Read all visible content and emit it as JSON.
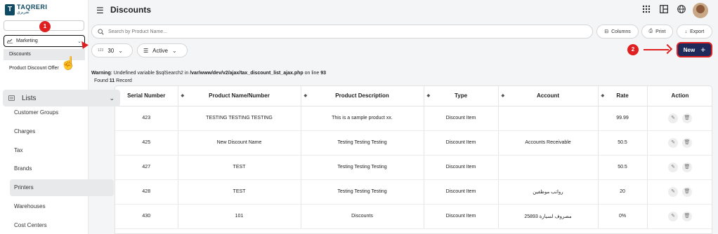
{
  "app": {
    "logo_en": "TAQRERI",
    "logo_ar": "تقريري",
    "logo_letter": "T"
  },
  "sidebar": {
    "marketing_label": "Marketing",
    "marketing_items": [
      "Discounts",
      "Product Discount Offer"
    ],
    "lists_label": "Lists",
    "list_items": [
      "Customer Groups",
      "Charges",
      "Tax",
      "Brands",
      "Printers",
      "Warehouses",
      "Cost Centers"
    ]
  },
  "annotations": {
    "step1": "1",
    "step2": "2"
  },
  "header": {
    "title": "Discounts"
  },
  "toolbar": {
    "search_placeholder": "Search by Product Name...",
    "columns_label": "Columns",
    "print_label": "Print",
    "export_label": "Export",
    "page_size_prefix": "123",
    "page_size": "30",
    "status_filter": "Active",
    "new_label": "New"
  },
  "messages": {
    "warning_prefix": "Warning",
    "warning_text": ": Undefined variable $sqlSearch2 in ",
    "warning_path": "/var/www/dev/v2/ajax/tax_discount_list_ajax.php",
    "warning_line_text": " on line ",
    "warning_line": "93",
    "found_prefix": "Found ",
    "found_count": "11",
    "found_suffix": " Record"
  },
  "table": {
    "headers": [
      "Serial Number",
      "Product Name/Number",
      "Product Description",
      "Type",
      "Account",
      "Rate",
      "Action"
    ],
    "rows": [
      [
        "423",
        "TESTING TESTING TESTING",
        "This is a sample product xx.",
        "Discount Item",
        "",
        "99.99"
      ],
      [
        "425",
        "New Discount Name",
        "Testing Testing Testing",
        "Discount Item",
        "Accounts Receivable",
        "50.5"
      ],
      [
        "427",
        "TEST",
        "Testing Testing Testing",
        "Discount Item",
        "",
        "50.5"
      ],
      [
        "428",
        "TEST",
        "Testing Testing Testing",
        "Discount Item",
        "رواتب موظفين",
        "20"
      ],
      [
        "430",
        "101",
        "Discounts",
        "Discount Item",
        "مصروف لسيارة 25893",
        "0%"
      ]
    ]
  },
  "colors": {
    "accent": "#1f2a5a",
    "annotation": "#e02020",
    "logo": "#0d4a63"
  }
}
